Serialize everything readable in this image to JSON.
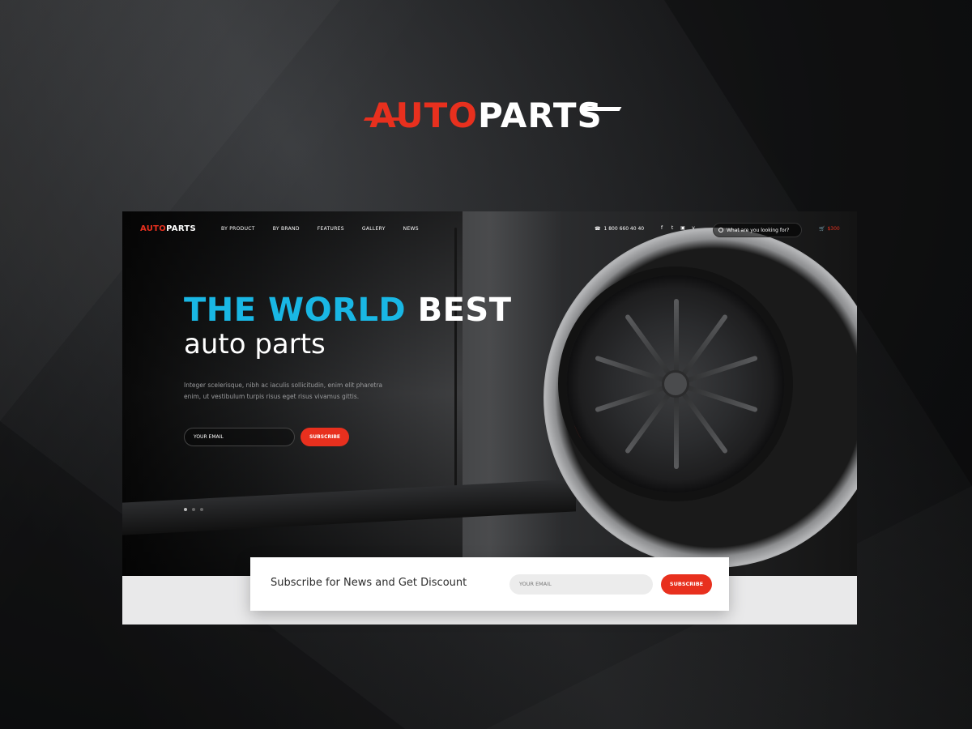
{
  "brand": {
    "logo_auto": "AUTO",
    "logo_parts": "PARTS",
    "accent_color": "#e8301e",
    "headline_blue": "#19b7e4"
  },
  "nav": {
    "logo_auto": "AUTO",
    "logo_parts": "PARTS",
    "menu": [
      "BY PRODUCT",
      "BY BRAND",
      "FEATURES",
      "GALLERY",
      "NEWS"
    ],
    "phone": "1 800 660 40 40",
    "phone_icon": "phone-icon",
    "social_icons": [
      "facebook-icon",
      "twitter-icon",
      "instagram-icon",
      "vimeo-icon"
    ],
    "social_glyphs": [
      "f",
      "t",
      "▣",
      "v"
    ],
    "search_placeholder": "What are you looking for?",
    "cart_total": "$300"
  },
  "hero": {
    "headline_part1": "THE WORLD",
    "headline_part2": "BEST",
    "subhead": "auto parts",
    "description": "Integer scelerisque, nibh ac iaculis sollicitudin, enim elit pharetra enim, ut vestibulum turpis risus eget risus vivamus gittis.",
    "email_placeholder": "YOUR EMAIL",
    "subscribe_label": "SUBSCRIBE",
    "slides": 3,
    "active_slide": 1
  },
  "subscribe_bar": {
    "label": "Subscribe for News and Get Discount",
    "email_placeholder": "YOUR EMAIL",
    "button_label": "SUBSCRIBE"
  }
}
